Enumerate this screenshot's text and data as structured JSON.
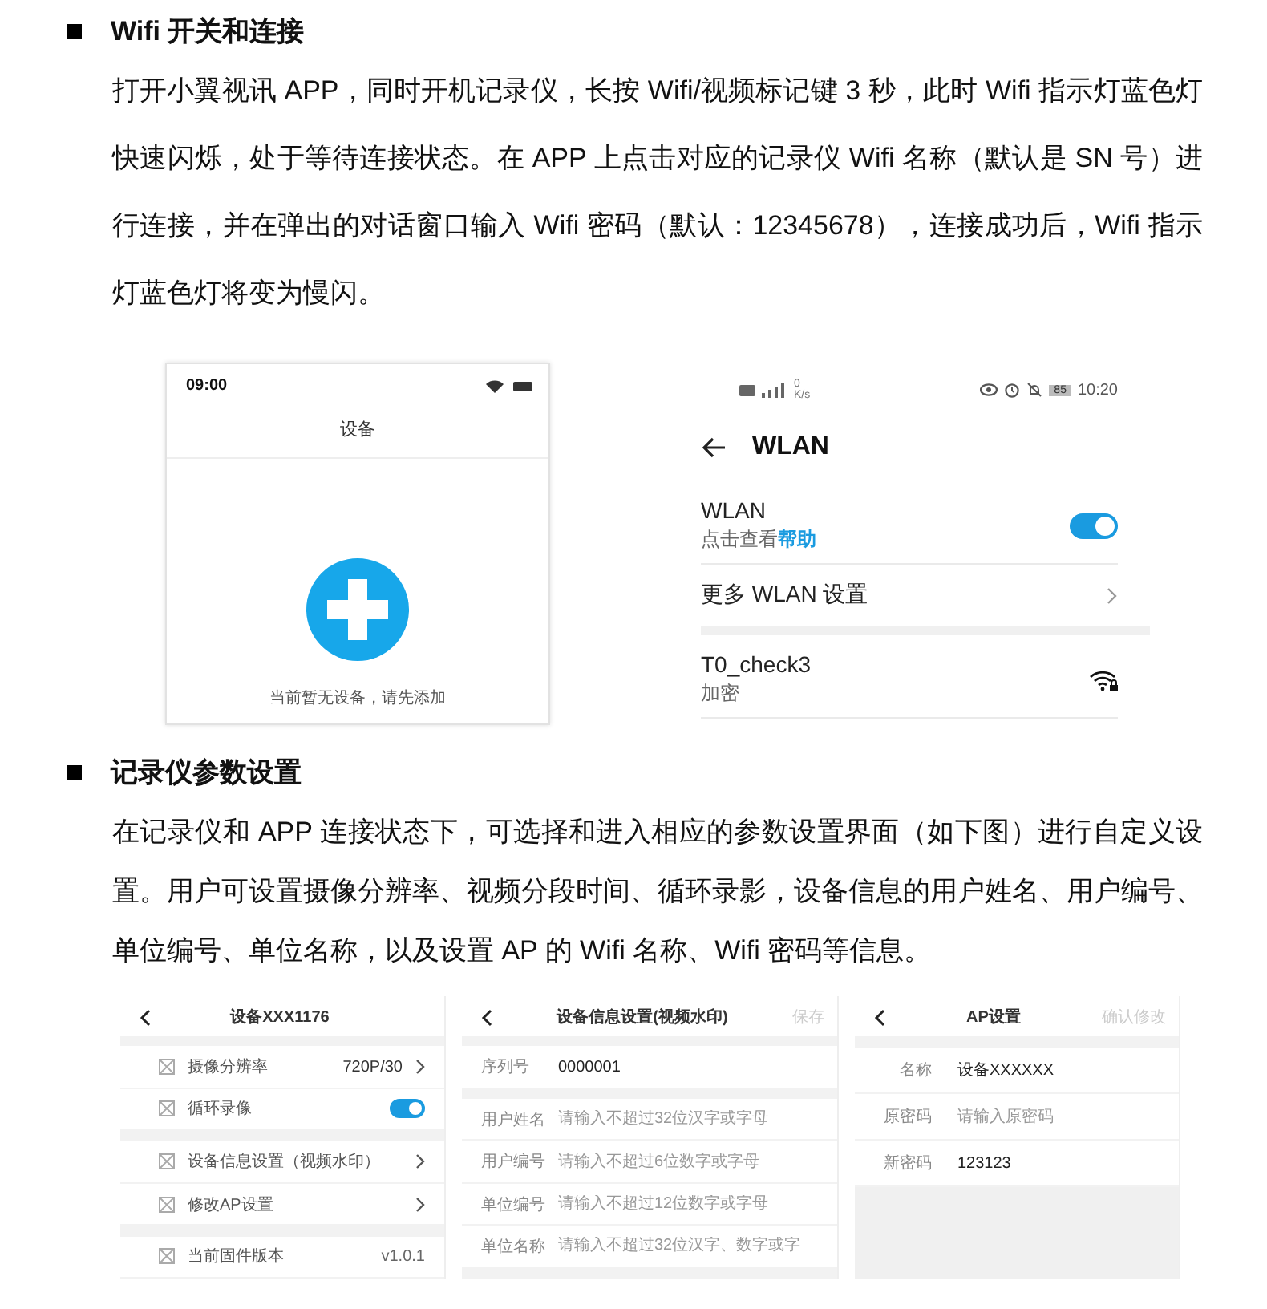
{
  "section_1": {
    "heading": "Wifi 开关和连接",
    "paragraph": "打开小翼视讯 APP，同时开机记录仪，长按 Wifi/视频标记键 3 秒，此时 Wifi 指示灯蓝色灯快速闪烁，处于等待连接状态。在 APP 上点击对应的记录仪 Wifi 名称（默认是 SN 号）进行连接，并在弹出的对话窗口输入 Wifi 密码（默认：12345678），连接成功后，Wifi 指示灯蓝色灯将变为慢闪。"
  },
  "device_screen": {
    "time": "09:00",
    "title": "设备",
    "empty_message": "当前暂无设备，请先添加"
  },
  "wlan_screen": {
    "speed_value": "0",
    "speed_unit": "K/s",
    "battery": "85",
    "time": "10:20",
    "title": "WLAN",
    "wlan_toggle": {
      "label": "WLAN",
      "hint": "点击查看",
      "link": "帮助",
      "on": true
    },
    "more_settings": "更多 WLAN 设置",
    "networks": [
      {
        "name": "T0_check3",
        "security": "加密"
      }
    ]
  },
  "section_2": {
    "heading": "记录仪参数设置",
    "paragraph": "在记录仪和 APP 连接状态下，可选择和进入相应的参数设置界面（如下图）进行自定义设置。用户可设置摄像分辨率、视频分段时间、循环录影，设备信息的用户姓名、用户编号、单位编号、单位名称，以及设置 AP 的 Wifi 名称、Wifi 密码等信息。"
  },
  "device_settings": {
    "title": "设备XXX1176",
    "groups": [
      [
        {
          "kind": "select",
          "label": "摄像分辨率",
          "value": "720P/30"
        },
        {
          "kind": "toggle",
          "label": "循环录像",
          "on": true
        }
      ],
      [
        {
          "kind": "link",
          "label": "设备信息设置（视频水印）"
        },
        {
          "kind": "link",
          "label": "修改AP设置"
        }
      ],
      [
        {
          "kind": "info",
          "label": "当前固件版本",
          "value": "v1.0.1"
        }
      ]
    ]
  },
  "info_settings": {
    "title": "设备信息设置(视频水印)",
    "action": "保存",
    "groups": [
      [
        {
          "label": "序列号",
          "value": "0000001"
        }
      ],
      [
        {
          "label": "用户姓名",
          "placeholder": "请输入不超过32位汉字或字母"
        },
        {
          "label": "用户编号",
          "placeholder": "请输入不超过6位数字或字母"
        },
        {
          "label": "单位编号",
          "placeholder": "请输入不超过12位数字或字母"
        },
        {
          "label": "单位名称",
          "placeholder": "请输入不超过32位汉字、数字或字"
        }
      ]
    ]
  },
  "ap_settings": {
    "title": "AP设置",
    "action": "确认修改",
    "rows": [
      {
        "label": "名称",
        "value": "设备XXXXXX"
      },
      {
        "label": "原密码",
        "placeholder": "请输入原密码"
      },
      {
        "label": "新密码",
        "value": "123123"
      }
    ]
  }
}
